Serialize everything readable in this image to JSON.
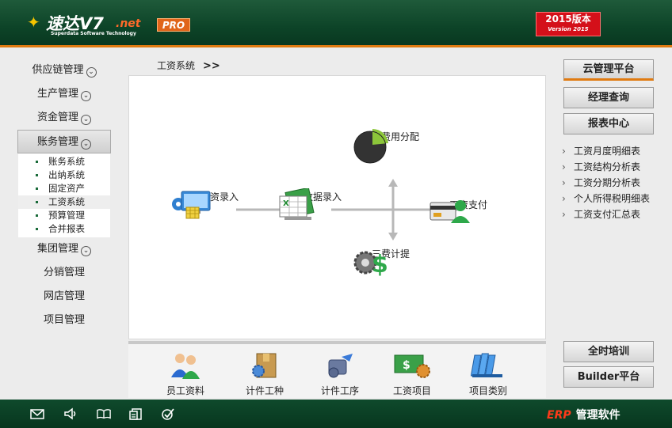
{
  "header": {
    "logo_name": "速达V7",
    "logo_net": ".net",
    "logo_sub": "Superdata Software Technology",
    "pro_badge": "PRO",
    "version_title": "2015版本",
    "version_sub": "Version 2015"
  },
  "leftnav": {
    "items": [
      {
        "label": "供应链管理"
      },
      {
        "label": "生产管理"
      },
      {
        "label": "资金管理"
      },
      {
        "label": "账务管理"
      },
      {
        "label": "集团管理"
      },
      {
        "label": "分销管理"
      },
      {
        "label": "网店管理"
      },
      {
        "label": "项目管理"
      }
    ],
    "submenu": [
      {
        "label": "账务系统"
      },
      {
        "label": "出纳系统"
      },
      {
        "label": "固定资产"
      },
      {
        "label": "工资系统"
      },
      {
        "label": "预算管理"
      },
      {
        "label": "合并报表"
      }
    ]
  },
  "breadcrumb": {
    "title": "工资系统",
    "arrow": ">>"
  },
  "workflow": {
    "piecework": "计件工资录入",
    "data_entry": "工资数据录入",
    "cost_alloc": "工资费用分配",
    "payment": "工资支付",
    "three_fees": "三费计提"
  },
  "tools": [
    {
      "label": "员工资料"
    },
    {
      "label": "计件工种"
    },
    {
      "label": "计件工序"
    },
    {
      "label": "工资项目"
    },
    {
      "label": "项目类别"
    }
  ],
  "right": {
    "buttons": [
      {
        "label": "云管理平台"
      },
      {
        "label": "经理查询"
      },
      {
        "label": "报表中心"
      },
      {
        "label": "全时培训"
      },
      {
        "label": "Builder平台"
      }
    ],
    "reports": [
      {
        "label": "工资月度明细表"
      },
      {
        "label": "工资结构分析表"
      },
      {
        "label": "工资分期分析表"
      },
      {
        "label": "个人所得税明细表"
      },
      {
        "label": "工资支付汇总表"
      }
    ]
  },
  "footer": {
    "erp": "ERP",
    "product": "管理软件"
  },
  "colors": {
    "brand_green": "#0d4428",
    "accent_orange": "#e07a10",
    "version_red": "#d4101a"
  }
}
